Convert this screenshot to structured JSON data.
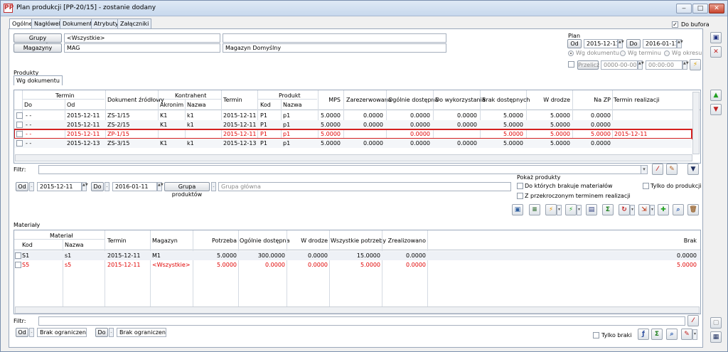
{
  "window": {
    "title": "Plan produkcji [PP-20/15] - zostanie dodany",
    "app_icon": "PP"
  },
  "tabs": [
    "Ogólne",
    "Nagłówek",
    "Dokumenty",
    "Atrybuty",
    "Załączniki"
  ],
  "do_bufora": {
    "label": "Do bufora",
    "checked": true
  },
  "top": {
    "grupy_button": "Grupy produktów",
    "grupy_value": "<Wszystkie>",
    "magazyny_button": "Magazyny",
    "magazyn_code": "MAG",
    "magazyn_name": "Magazyn Domyślny"
  },
  "plan": {
    "label": "Plan",
    "od_button": "Od",
    "od_value": "2015-12-11",
    "do_button": "Do",
    "do_value": "2016-01-11",
    "radios": [
      "Wg dokumentu",
      "Wg terminu",
      "Wg okresu"
    ],
    "selected_radio": "Wg dokumentu",
    "przelicz_label": "Przelicz",
    "przelicz_date": "0000-00-00",
    "przelicz_time": "00:00:00"
  },
  "produkty": {
    "label": "Produkty",
    "subtab": "Wg dokumentu",
    "group_headers": {
      "termin": "Termin",
      "kontrahent": "Kontrahent",
      "produkt": "Produkt"
    },
    "columns": [
      "Do",
      "Od",
      "Dokument źródłowy",
      "Akronim",
      "Nazwa",
      "Termin",
      "Kod",
      "Nazwa",
      "MPS",
      "Zarezerwowana",
      "Ogólnie dostępna",
      "Do wykorzystania",
      "Brak dostępnych",
      "W drodze",
      "Na ZP",
      "Termin realizacji"
    ],
    "rows": [
      {
        "do": "- -",
        "od": "2015-12-11",
        "dok": "ZS-1/15",
        "akronim": "K1",
        "nazwa": "k1",
        "termin": "2015-12-11",
        "kod": "P1",
        "pnazwa": "p1",
        "mps": "5.0000",
        "zarez": "0.0000",
        "ogolnie": "0.0000",
        "dowyk": "0.0000",
        "brak": "5.0000",
        "wdrodze": "5.0000",
        "nazp": "0.0000",
        "trealiz": "",
        "red": false
      },
      {
        "do": "- -",
        "od": "2015-12-11",
        "dok": "ZS-2/15",
        "akronim": "K1",
        "nazwa": "k1",
        "termin": "2015-12-11",
        "kod": "P1",
        "pnazwa": "p1",
        "mps": "5.0000",
        "zarez": "0.0000",
        "ogolnie": "0.0000",
        "dowyk": "0.0000",
        "brak": "5.0000",
        "wdrodze": "5.0000",
        "nazp": "0.0000",
        "trealiz": "",
        "red": false
      },
      {
        "do": "- -",
        "od": "2015-12-11",
        "dok": "ZP-1/15",
        "akronim": "",
        "nazwa": "",
        "termin": "2015-12-11",
        "kod": "P1",
        "pnazwa": "p1",
        "mps": "5.0000",
        "zarez": "",
        "ogolnie": "0.0000",
        "dowyk": "",
        "brak": "5.0000",
        "wdrodze": "5.0000",
        "nazp": "5.0000",
        "trealiz": "2015-12-11",
        "red": true
      },
      {
        "do": "- -",
        "od": "2015-12-13",
        "dok": "ZS-3/15",
        "akronim": "K1",
        "nazwa": "k1",
        "termin": "2015-12-13",
        "kod": "P1",
        "pnazwa": "p1",
        "mps": "5.0000",
        "zarez": "0.0000",
        "ogolnie": "0.0000",
        "dowyk": "0.0000",
        "brak": "5.0000",
        "wdrodze": "5.0000",
        "nazp": "0.0000",
        "trealiz": "",
        "red": false
      }
    ]
  },
  "filter": {
    "label": "Filtr:",
    "value": ""
  },
  "date_filter": {
    "od_button": "Od",
    "od_value": "2015-12-11",
    "do_button": "Do",
    "do_value": "2016-01-11",
    "grupa_button": "Grupa produktów",
    "grupa_placeholder": "Grupa główna"
  },
  "pokaz": {
    "label": "Pokaż produkty",
    "opt1": "Do których brakuje materiałów",
    "opt2": "Tylko do produkcji",
    "opt3": "Z przekroczonym terminem realizacji"
  },
  "materialy": {
    "label": "Materiały",
    "group_header": "Materiał",
    "columns": [
      "Kod",
      "Nazwa",
      "Termin",
      "Magazyn",
      "Potrzeba",
      "Ogólnie dostępna",
      "W drodze",
      "Wszystkie potrzeby",
      "Zrealizowano",
      "Brak"
    ],
    "rows": [
      {
        "kod": "S1",
        "nazwa": "s1",
        "termin": "2015-12-11",
        "magazyn": "M1",
        "potrzeba": "5.0000",
        "ogolnie": "300.0000",
        "wdrodze": "0.0000",
        "wszystkie": "15.0000",
        "zreal": "0.0000",
        "brak": "0.0000",
        "red": false
      },
      {
        "kod": "S5",
        "nazwa": "s5",
        "termin": "2015-12-11",
        "magazyn": "<Wszystkie>",
        "potrzeba": "5.0000",
        "ogolnie": "0.0000",
        "wdrodze": "0.0000",
        "wszystkie": "5.0000",
        "zreal": "0.0000",
        "brak": "5.0000",
        "red": true
      }
    ]
  },
  "bottom": {
    "filter_label": "Filtr:",
    "od_button": "Od",
    "od_value": "Brak ograniczenia",
    "do_button": "Do",
    "do_value": "Brak ograniczenia",
    "tylko_braki": "Tylko braki"
  },
  "colors": {
    "highlight_border": "#d42020",
    "red_text": "#e00000"
  }
}
